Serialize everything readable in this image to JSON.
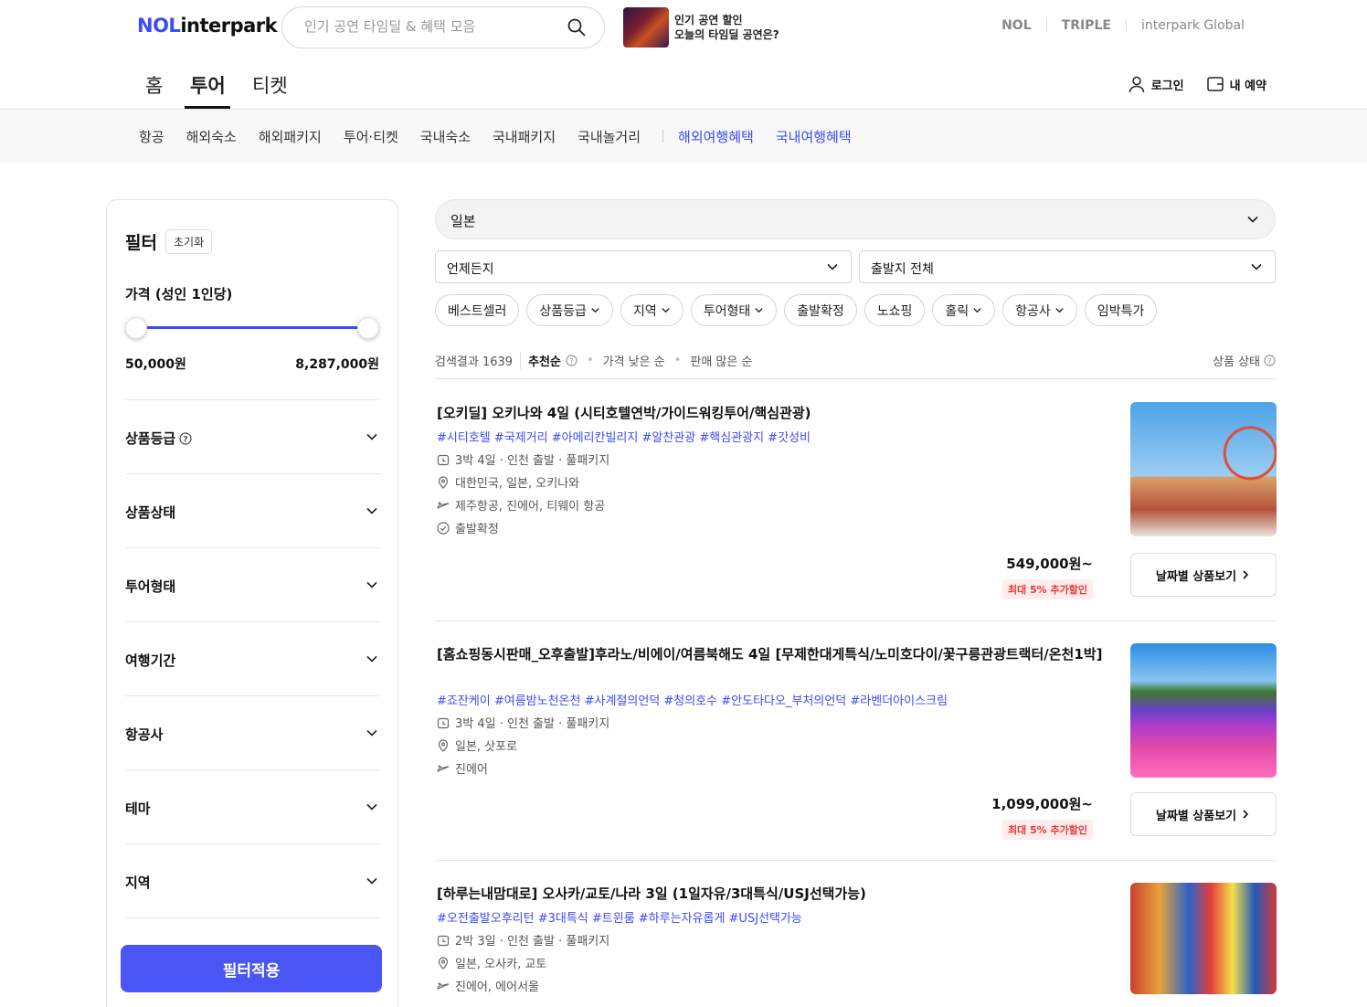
{
  "header": {
    "logo_nol": "NOL",
    "logo_interpark": "interpark",
    "search_placeholder": "인기 공연 타임딜 & 혜택 모음",
    "promo_line1": "인기 공연 할인",
    "promo_line2": "오늘의 타임딜 공연은?",
    "brands": [
      "NOL",
      "TRIPLE",
      "interpark Global"
    ]
  },
  "main_nav": {
    "tabs": [
      {
        "label": "홈",
        "active": false
      },
      {
        "label": "투어",
        "active": true
      },
      {
        "label": "티켓",
        "active": false
      }
    ],
    "login": "로그인",
    "my_reservation": "내 예약"
  },
  "sub_nav": {
    "items": [
      "항공",
      "해외숙소",
      "해외패키지",
      "투어·티켓",
      "국내숙소",
      "국내패키지",
      "국내놀거리"
    ],
    "highlight_items": [
      "해외여행혜택",
      "국내여행혜택"
    ]
  },
  "filter": {
    "title": "필터",
    "reset": "초기화",
    "price_label": "가격 (성인 1인당)",
    "price_min": "50,000원",
    "price_max": "8,287,000원",
    "sections": [
      "상품등급",
      "상품상태",
      "투어형태",
      "여행기간",
      "항공사",
      "테마",
      "지역"
    ],
    "apply": "필터적용"
  },
  "search": {
    "destination": "일본",
    "date": "언제든지",
    "departure": "출발지 전체",
    "chips": [
      {
        "label": "베스트셀러",
        "dropdown": false
      },
      {
        "label": "상품등급",
        "dropdown": true
      },
      {
        "label": "지역",
        "dropdown": true
      },
      {
        "label": "투어형태",
        "dropdown": true
      },
      {
        "label": "출발확정",
        "dropdown": false
      },
      {
        "label": "노쇼핑",
        "dropdown": false
      },
      {
        "label": "홀릭",
        "dropdown": true
      },
      {
        "label": "항공사",
        "dropdown": true
      },
      {
        "label": "임박특가",
        "dropdown": false
      }
    ],
    "result_label": "검색결과 1639",
    "sort_options": [
      "추천순",
      "가격 낮은 순",
      "판매 많은 순"
    ],
    "status_label": "상품 상태"
  },
  "products": [
    {
      "title": "[오키딜] 오키나와 4일 (시티호텔연박/가이드워킹투어/핵심관광)",
      "tags": "#시티호텔 #국제거리 #아메리칸빌리지 #알찬관광 #핵심관광지 #갓성비",
      "duration": "3박 4일 · 인천 출발 · 풀패키지",
      "location": "대한민국, 일본, 오키나와",
      "airline": "제주항공, 진에어, 티웨이 항공",
      "status": "출발확정",
      "price": "549,000원~",
      "discount": "최대 5% 추가할인",
      "button": "날짜별 상품보기"
    },
    {
      "title": "[홈쇼핑동시판매_오후출발]후라노/비에이/여름북해도 4일 [무제한대게특식/노미호다이/꽃구릉관광트랙터/온천1박]",
      "tags": "#죠잔케이 #여름밤노천온천 #사계절의언덕 #청의호수 #안도타다오_부처의언덕 #라벤더아이스크림",
      "duration": "3박 4일 · 인천 출발 · 풀패키지",
      "location": "일본, 삿포로",
      "airline": "진에어",
      "price": "1,099,000원~",
      "discount": "최대 5% 추가할인",
      "button": "날짜별 상품보기"
    },
    {
      "title": "[하루는내맘대로] 오사카/교토/나라 3일 (1일자유/3대특식/USJ선택가능)",
      "tags": "#오전출발오후리턴 #3대특식 #트윈룸 #하루는자유롭게 #USJ선택가능",
      "duration": "2박 3일 · 인천 출발 · 풀패키지",
      "location": "일본, 오사카, 교토",
      "airline": "진에어, 에어서울"
    }
  ],
  "colors": {
    "accent": "#3d4bf5",
    "discount": "#e53935"
  }
}
